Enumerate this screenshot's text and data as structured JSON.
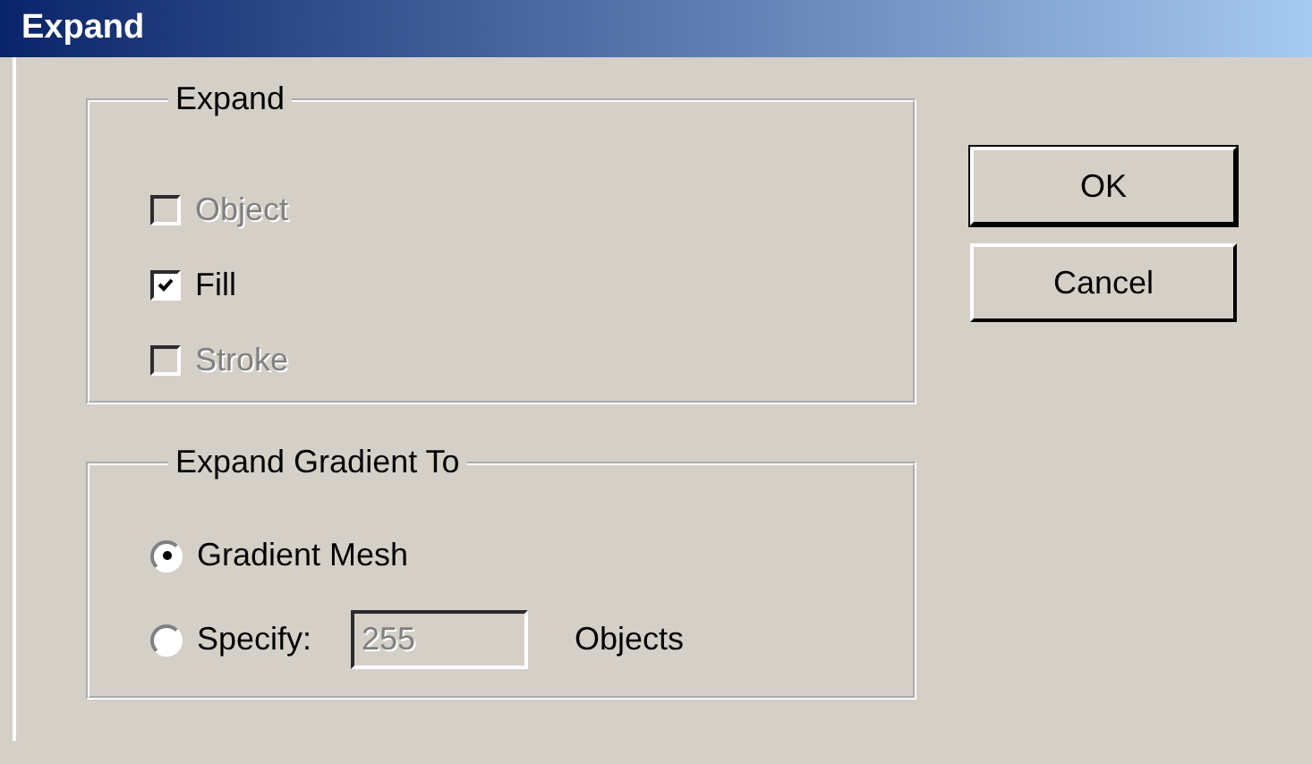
{
  "window": {
    "title": "Expand"
  },
  "expand_group": {
    "label": "Expand",
    "options": [
      {
        "label": "Object",
        "checked": false,
        "disabled": true
      },
      {
        "label": "Fill",
        "checked": true,
        "disabled": false
      },
      {
        "label": "Stroke",
        "checked": false,
        "disabled": true
      }
    ]
  },
  "gradient_group": {
    "label": "Expand Gradient To",
    "options": [
      {
        "label": "Gradient Mesh",
        "selected": true
      },
      {
        "label": "Specify:",
        "selected": false
      }
    ],
    "specify_field": {
      "value": "255",
      "disabled": true
    },
    "unit": "Objects"
  },
  "buttons": [
    {
      "label": "OK",
      "default": true
    },
    {
      "label": "Cancel",
      "default": false
    }
  ]
}
